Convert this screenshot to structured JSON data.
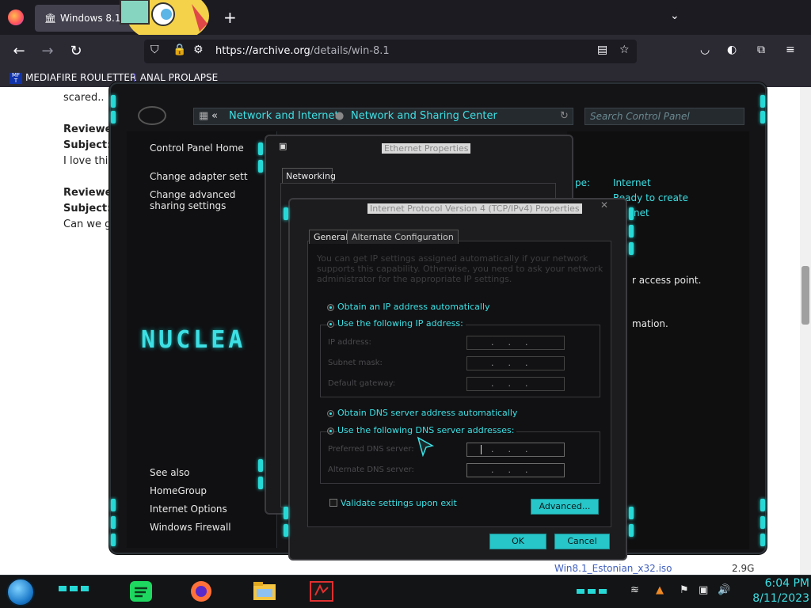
{
  "browser": {
    "tab_title": "Windows 8.1",
    "url_host": "https://archive.org",
    "url_path": "/details/win-8.1",
    "bookmarks": [
      {
        "label": "MEDIAFIRE ROULETTER",
        "icon_text": "MF T"
      },
      {
        "label": "ANAL PROLAPSE"
      }
    ]
  },
  "page": {
    "lines": [
      "scared..",
      "Reviewe",
      "Subject:",
      "I love this",
      "Reviewe",
      "Subject: I",
      "Can we ge"
    ],
    "download": {
      "file": "Win8.1_Estonian_x32.iso",
      "size": "2.9G"
    }
  },
  "control_panel": {
    "breadcrumb_back": "«",
    "breadcrumb": [
      "Network and Internet",
      "Network and Sharing Center"
    ],
    "search_placeholder": "Search Control Panel",
    "sidebar": [
      "Control Panel Home",
      "Change adapter settings",
      "Change advanced sharing settings"
    ],
    "see_also_title": "See also",
    "see_also": [
      "HomeGroup",
      "Internet Options",
      "Windows Firewall"
    ],
    "theme_logo": "NUCLEA",
    "main_fragments": {
      "access_type_label": "pe:",
      "access_type_value": "Internet",
      "homegroup": "Ready to create",
      "connection": "net",
      "line1": "r access point.",
      "line2": "mation."
    }
  },
  "ethernet_dialog": {
    "title": "Ethernet Properties",
    "tab": "Networking"
  },
  "ipv4_dialog": {
    "title": "Internet Protocol Version 4 (TCP/IPv4) Properties",
    "tabs": [
      "General",
      "Alternate Configuration"
    ],
    "description": "You can get IP settings assigned automatically if your network supports this capability. Otherwise, you need to ask your network administrator for the appropriate IP settings.",
    "ip_auto": "Obtain an IP address automatically",
    "ip_manual": "Use the following IP address:",
    "ip_fields": [
      "IP address:",
      "Subnet mask:",
      "Default gateway:"
    ],
    "dns_auto": "Obtain DNS server address automatically",
    "dns_manual": "Use the following DNS server addresses:",
    "dns_fields": [
      "Preferred DNS server:",
      "Alternate DNS server:"
    ],
    "ip_placeholder": "...",
    "validate_label": "Validate settings upon exit",
    "validate_checked": false,
    "selected_ip_option": "manual",
    "selected_dns_option": "manual",
    "advanced_button": "Advanced...",
    "ok_button": "OK",
    "cancel_button": "Cancel"
  },
  "taskbar": {
    "time": "6:04 PM",
    "date": "8/11/2023",
    "apps": [
      "spotify-icon",
      "firefox-icon",
      "file-explorer-icon",
      "nuclear-theme-icon"
    ],
    "tray": [
      "speaker-icon",
      "network-icon",
      "flag-icon",
      "app-tray-icon"
    ]
  },
  "colors": {
    "accent": "#3de0e4",
    "browser_bg": "#2b2a33",
    "dialog_bg": "#1c1c1e"
  }
}
